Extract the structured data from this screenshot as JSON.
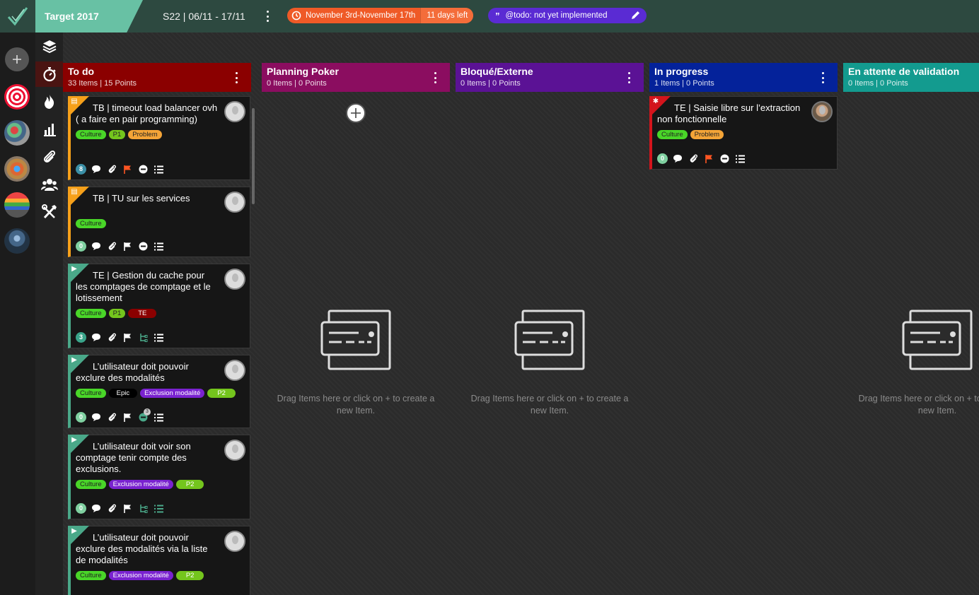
{
  "project": "Target 2017",
  "sprint": "S22 | 06/11 - 17/11",
  "dates": {
    "range": "November 3rd-November 17th",
    "left": "11 days left"
  },
  "goal": {
    "quote": "”",
    "text": "@todo: not yet implemented"
  },
  "icons": {
    "logo": "checkmark-logo-icon",
    "add": "plus-icon",
    "layers": "layers-icon",
    "timer": "stopwatch-icon",
    "fire": "flame-icon",
    "chart": "bar-chart-icon",
    "attach": "paperclip-icon",
    "team": "team-icon",
    "tools": "tools-icon"
  },
  "colors": {
    "topbar": "#2d4940",
    "project": "#68c1a4",
    "dates": "#ef5a27",
    "goal": "#5a2bd3",
    "activeMenu": "#4a1412"
  },
  "columns": [
    {
      "title": "To do",
      "sub": "33 Items | 15 Points",
      "color": "#8b0000"
    },
    {
      "title": "Planning Poker",
      "sub": "0 Items | 0 Points",
      "color": "#8b0d60"
    },
    {
      "title": "Bloqué/Externe",
      "sub": "0 Items | 0 Points",
      "color": "#5b1295"
    },
    {
      "title": "In progress",
      "sub": "1 Items | 0 Points",
      "color": "#04229a"
    },
    {
      "title": "En attente de validation",
      "sub": "0 Items | 0 Points",
      "color": "#139b8f"
    }
  ],
  "empty_text": "Drag Items here or click on + to create a new Item.",
  "cards": {
    "todo": [
      {
        "title": "TB | timeout load balancer ovh ( a faire en pair programming)",
        "kind": "task-icon",
        "tags": [
          "Culture",
          "P1",
          "Problem"
        ],
        "count": "8"
      },
      {
        "title": "TB | TU sur les services",
        "kind": "task-icon",
        "tags": [
          "Culture"
        ],
        "count": "0"
      },
      {
        "title": "TE | Gestion du cache pour les comptages de comptage et le lotissement",
        "kind": "story-icon",
        "tags": [
          "Culture",
          "P1",
          "TE"
        ],
        "count": "3"
      },
      {
        "title": "L’utilisateur doit pouvoir exclure des modalités",
        "kind": "story-icon",
        "tags": [
          "Culture",
          "Epic",
          "Exclusion modalité",
          "P2"
        ],
        "count": "0",
        "badge": "3"
      },
      {
        "title": "L’utilisateur doit voir son comptage tenir compte des exclusions.",
        "kind": "story-icon",
        "tags": [
          "Culture",
          "Exclusion modalité",
          "P2"
        ],
        "count": "0"
      },
      {
        "title": "L’utilisateur doit pouvoir exclure des modalités via la liste de modalités",
        "kind": "story-icon",
        "tags": [
          "Culture",
          "Exclusion modalité",
          "P2"
        ],
        "count": "0"
      }
    ],
    "progress": [
      {
        "title": "TE | Saisie libre sur l’extraction non fonctionnelle",
        "kind": "bug-icon",
        "tags": [
          "Culture",
          "Problem"
        ],
        "count": "0"
      }
    ]
  }
}
